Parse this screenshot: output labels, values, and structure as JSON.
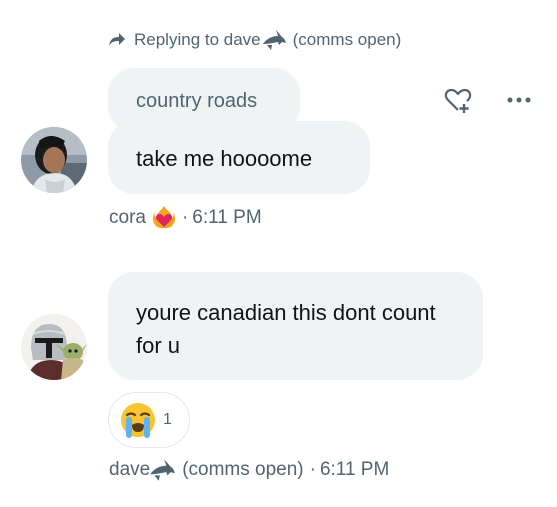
{
  "reply": {
    "prefix": "Replying to dave",
    "suffix": "(comms open)"
  },
  "message1": {
    "quoted_text": "country roads",
    "text": "take me hoooome",
    "sender": "cora",
    "separator": "·",
    "time": "6:11 PM"
  },
  "message2": {
    "text": "youre canadian this dont count for u",
    "reaction_count": "1",
    "sender": "dave",
    "sender_suffix": "(comms open)",
    "separator": "·",
    "time": "6:11 PM"
  },
  "colors": {
    "bubble": "#eff3f4",
    "muted_text": "#536471",
    "text": "#0f1419"
  }
}
